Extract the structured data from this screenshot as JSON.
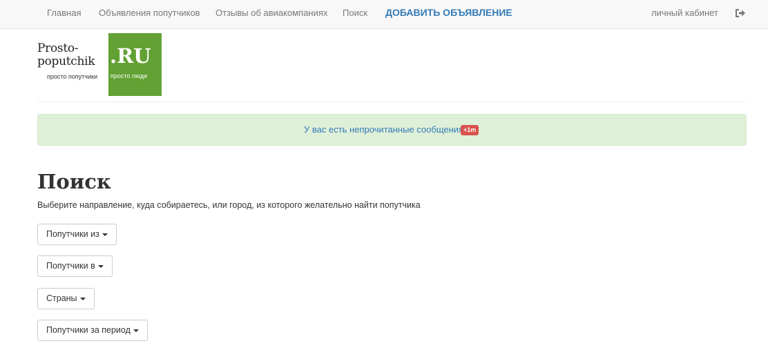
{
  "nav": {
    "items": [
      {
        "label": "Главная"
      },
      {
        "label": "Объявления попутчиков"
      },
      {
        "label": "Отзывы об авиакомпаниях"
      },
      {
        "label": "Поиск"
      },
      {
        "label": "ДОБАВИТЬ ОБЪЯВЛЕНИЕ"
      }
    ],
    "account_label": "личный кабинет",
    "logout_icon": "sign-out-icon"
  },
  "logo": {
    "line1": "Prosto-",
    "line2": "poputchik",
    "tagline": "просто попутчики",
    "domain": ".RU",
    "tagline2": "просто люди",
    "brand_green": "#62a133"
  },
  "alert": {
    "text": "У вас есть непрочитанные сообщения",
    "badge": "+1m"
  },
  "page": {
    "title": "Поиск",
    "description": "Выберите направление, куда собираетесь, или город, из которого желательно найти попутчика"
  },
  "filters": [
    {
      "label": "Попутчики из"
    },
    {
      "label": "Попутчики в"
    },
    {
      "label": "Страны"
    },
    {
      "label": "Попутчики за период"
    }
  ],
  "colors": {
    "link": "#337ab7",
    "alert_bg": "#dff0d8",
    "badge": "#d9534f"
  }
}
